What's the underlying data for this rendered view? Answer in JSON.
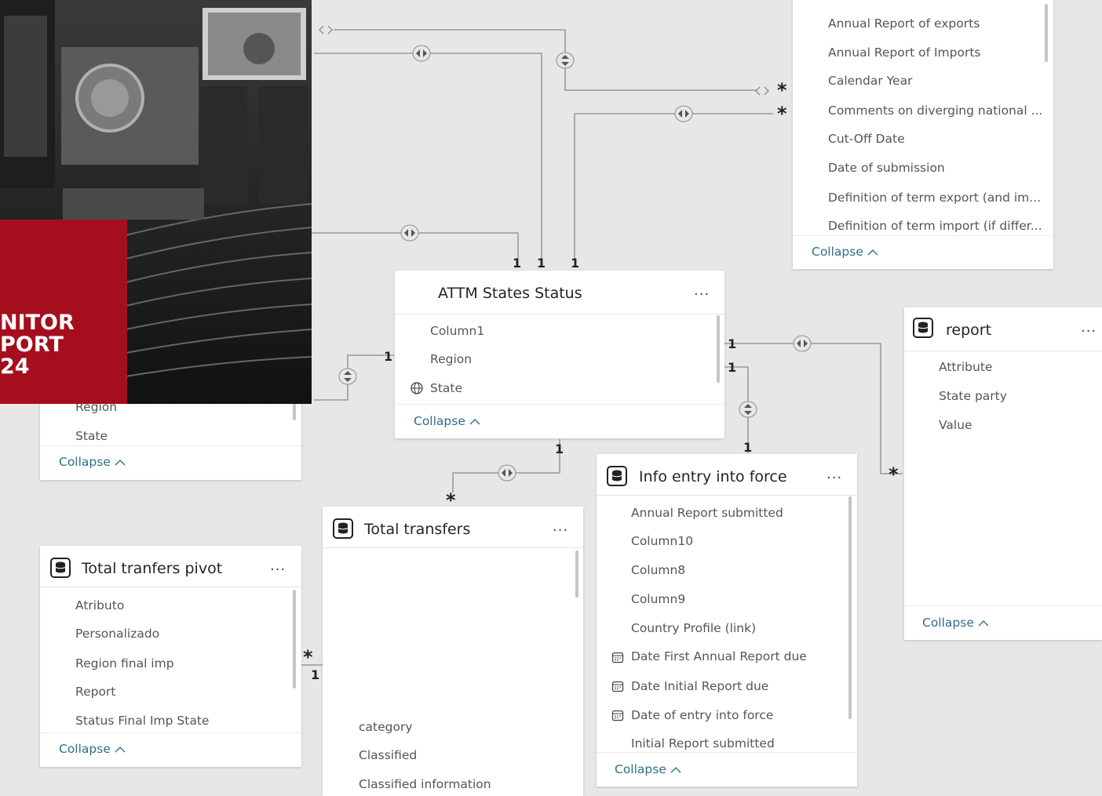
{
  "cards": {
    "annual": {
      "fields": [
        "Annual Report of exports",
        "Annual Report of Imports",
        "Calendar Year",
        "Comments on diverging national ...",
        "Cut-Off Date",
        "Date of submission",
        "Definition of term export (and im...",
        "Definition of term import (if differ..."
      ],
      "collapse": "Collapse"
    },
    "attm": {
      "title": "ATTM States Status",
      "fields": [
        "Column1",
        "Region",
        "State"
      ],
      "collapse": "Collapse"
    },
    "leftcut": {
      "fields": [
        "Region",
        "State"
      ],
      "collapse": "Collapse"
    },
    "report": {
      "title": "report",
      "fields": [
        "Attribute",
        "State party",
        "Value"
      ],
      "collapse": "Collapse"
    },
    "info": {
      "title": "Info entry into force",
      "fields": [
        "Annual Report submitted",
        "Column10",
        "Column8",
        "Column9",
        "Country Profile (link)",
        "Date First Annual Report due",
        "Date Initial Report due",
        "Date of entry into force",
        "Initial Report submitted"
      ],
      "collapse": "Collapse"
    },
    "total": {
      "title": "Total transfers",
      "fields": [
        "category",
        "Classified",
        "Classified information"
      ]
    },
    "pivot": {
      "title": "Total tranfers pivot",
      "fields": [
        "Atributo",
        "Personalizado",
        "Region final imp",
        "Report",
        "Status Final Imp State"
      ],
      "collapse": "Collapse"
    }
  },
  "more_label": "...",
  "relationship_labels": {
    "one": "1",
    "many": "*"
  },
  "banner": {
    "lines": [
      "NITOR",
      "PORT",
      "24"
    ]
  },
  "icons": {
    "table": "database-icon",
    "geo": "globe-icon",
    "date": "calendar-icon",
    "crossfilter_both": "double-arrow-horizontal-icon",
    "crossfilter_vertical": "double-arrow-vertical-icon",
    "collapse": "chevron-up-icon"
  },
  "colors": {
    "canvas": "#e8e7e6",
    "card": "#ffffff",
    "collapse_link": "#2f6e8a",
    "banner_red": "#a50f1d",
    "line": "#8a8a8a"
  }
}
